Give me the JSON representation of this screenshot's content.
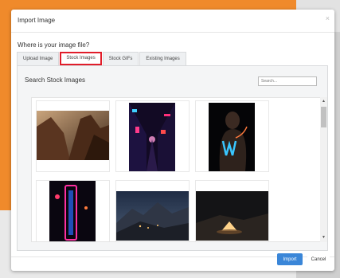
{
  "dialog": {
    "title": "Import Image",
    "close_glyph": "×",
    "question": "Where is your image file?"
  },
  "tabs": [
    {
      "label": "Upload Image",
      "active": false
    },
    {
      "label": "Stock Images",
      "active": true
    },
    {
      "label": "Stock GIFs",
      "active": false
    },
    {
      "label": "Existing Images",
      "active": false
    }
  ],
  "panel": {
    "title": "Search Stock Images",
    "search_placeholder": "Search..."
  },
  "images": [
    {
      "subject": "desert canyon cliffs at sunset"
    },
    {
      "subject": "neon lit night alley"
    },
    {
      "subject": "woman with neon light painting"
    },
    {
      "subject": "neon Starlite vertical sign"
    },
    {
      "subject": "mountain town at dusk"
    },
    {
      "subject": "tent glowing in desert at night"
    }
  ],
  "scrollbar": {
    "up_glyph": "▲",
    "down_glyph": "▼"
  },
  "footer": {
    "import_label": "Import",
    "cancel_label": "Cancel"
  },
  "colors": {
    "accent": "#3a86d8",
    "tab_highlight": "#e11d2a",
    "backdrop_orange": "#f08a2b"
  }
}
